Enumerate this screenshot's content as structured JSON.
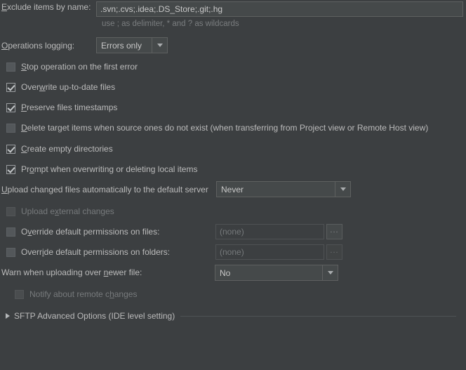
{
  "exclude": {
    "label_prefix": "E",
    "label_rest": "xclude items by name:",
    "value": ".svn;.cvs;.idea;.DS_Store;.git;.hg",
    "hint": "use ; as delimiter, * and ? as wildcards"
  },
  "operations_logging": {
    "label_prefix": "O",
    "label_rest": "perations logging:",
    "value": "Errors only"
  },
  "checkboxes": [
    {
      "name": "stop-operation-on-first-error",
      "prefix": "S",
      "rest": "top operation on the first error",
      "checked": false,
      "disabled": false
    },
    {
      "name": "overwrite-up-to-date-files",
      "pre": "Over",
      "prefix": "w",
      "rest": "rite up-to-date files",
      "checked": true,
      "disabled": false
    },
    {
      "name": "preserve-files-timestamps",
      "prefix": "P",
      "rest": "reserve files timestamps",
      "checked": true,
      "disabled": false
    },
    {
      "name": "delete-target-items",
      "prefix": "D",
      "rest": "elete target items when source ones do not exist (when transferring from Project view or Remote Host view)",
      "checked": false,
      "disabled": false
    },
    {
      "name": "create-empty-directories",
      "prefix": "C",
      "rest": "reate empty directories",
      "checked": true,
      "disabled": false
    },
    {
      "name": "prompt-when-overwriting",
      "pre": "Pr",
      "prefix": "o",
      "rest": "mpt when overwriting or deleting local items",
      "checked": true,
      "disabled": false
    }
  ],
  "upload_auto": {
    "label_prefix": "U",
    "label_rest": "pload changed files automatically to the default server",
    "value": "Never"
  },
  "upload_external": {
    "pre": "Upload e",
    "prefix": "x",
    "rest": "ternal changes",
    "checked": false,
    "disabled": true
  },
  "override_files": {
    "pre": "O",
    "prefix": "v",
    "rest": "erride default permissions on files:",
    "checked": false,
    "disabled": false,
    "value": "(none)",
    "browse": "..."
  },
  "override_folders": {
    "pre": "Override",
    "prefix": "i",
    "rest": "default permissions on folders:",
    "full_pre": "Overr",
    "full_mn": "i",
    "full_rest": "de default permissions on folders:",
    "checked": false,
    "disabled": false,
    "value": "(none)",
    "browse": "..."
  },
  "warn_newer": {
    "pre": "Warn when uploading over ",
    "prefix": "n",
    "rest": "ewer file:",
    "value": "No"
  },
  "notify_remote": {
    "pre": "Notify about remote c",
    "prefix": "h",
    "rest": "anges",
    "checked": false,
    "disabled": true
  },
  "advanced_section": {
    "title": "SFTP Advanced Options (IDE level setting)",
    "expanded": false
  },
  "colors": {
    "background": "#3c3f41",
    "field_background": "#45494a",
    "text": "#bbbbbb",
    "dim_text": "#777a7c",
    "border": "#5e6060"
  }
}
